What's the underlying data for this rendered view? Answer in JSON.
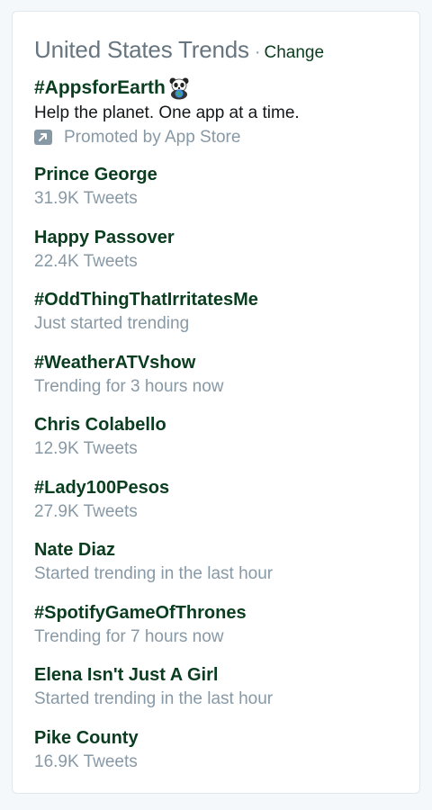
{
  "header": {
    "title": "United States Trends",
    "separator": "·",
    "change_label": "Change"
  },
  "promoted": {
    "name": "#AppsforEarth",
    "emoji": "panda-icon",
    "description": "Help the planet. One app at a time.",
    "promoted_by": "Promoted by App Store"
  },
  "trends": [
    {
      "name": "Prince George",
      "meta": "31.9K Tweets"
    },
    {
      "name": "Happy Passover",
      "meta": "22.4K Tweets"
    },
    {
      "name": "#OddThingThatIrritatesMe",
      "meta": "Just started trending"
    },
    {
      "name": "#WeatherATVshow",
      "meta": "Trending for 3 hours now"
    },
    {
      "name": "Chris Colabello",
      "meta": "12.9K Tweets"
    },
    {
      "name": "#Lady100Pesos",
      "meta": "27.9K Tweets"
    },
    {
      "name": "Nate Diaz",
      "meta": "Started trending in the last hour"
    },
    {
      "name": "#SpotifyGameOfThrones",
      "meta": "Trending for 7 hours now"
    },
    {
      "name": "Elena Isn't Just A Girl",
      "meta": "Started trending in the last hour"
    },
    {
      "name": "Pike County",
      "meta": "16.9K Tweets"
    }
  ],
  "colors": {
    "trend_name": "#0a3d1f",
    "meta": "#8899a6",
    "title": "#66757f",
    "border": "#e1e8ed"
  }
}
